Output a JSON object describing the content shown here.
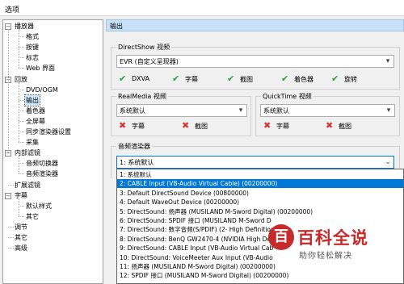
{
  "window": {
    "title": "选项"
  },
  "tree": [
    {
      "label": "播放器",
      "toggle": "−"
    },
    {
      "label": "格式"
    },
    {
      "label": "按键"
    },
    {
      "label": "标志"
    },
    {
      "label": "Web 界面"
    },
    {
      "label": "回放",
      "toggle": "−"
    },
    {
      "label": "DVD/OGM"
    },
    {
      "label": "输出"
    },
    {
      "label": "着色器"
    },
    {
      "label": "全屏幕"
    },
    {
      "label": "同步渲染器设置"
    },
    {
      "label": "采集"
    },
    {
      "label": "内部滤镜",
      "toggle": "−"
    },
    {
      "label": "音频切换器"
    },
    {
      "label": "音频渲染器"
    },
    {
      "label": "扩展滤镜"
    },
    {
      "label": "字幕",
      "toggle": "−"
    },
    {
      "label": "默认样式"
    },
    {
      "label": "其它"
    },
    {
      "label": "调节"
    },
    {
      "label": "其它"
    },
    {
      "label": "高级"
    }
  ],
  "panel": {
    "header": "输出",
    "directshow": {
      "label": "DirectShow 视频",
      "value": "EVR (自定义呈现器)",
      "features": [
        {
          "icon": "check-icon",
          "glyph": "✔",
          "label": "DXVA"
        },
        {
          "icon": "check-icon",
          "glyph": "✔",
          "label": "字幕"
        },
        {
          "icon": "check-icon",
          "glyph": "✔",
          "label": "截图"
        },
        {
          "icon": "check-icon",
          "glyph": "✔",
          "label": "着色器"
        },
        {
          "icon": "check-icon",
          "glyph": "✔",
          "label": "旋转"
        }
      ]
    },
    "realmedia": {
      "label": "RealMedia 视频",
      "value": "系统默认",
      "features": [
        {
          "icon": "cross-icon",
          "glyph": "✖",
          "label": "字幕"
        },
        {
          "icon": "cross-icon",
          "glyph": "✖",
          "label": "截图"
        }
      ]
    },
    "quicktime": {
      "label": "QuickTime 视频",
      "value": "系统默认",
      "features": [
        {
          "icon": "cross-icon",
          "glyph": "✖",
          "label": "字幕"
        },
        {
          "icon": "cross-icon",
          "glyph": "✖",
          "label": "截图"
        }
      ]
    },
    "audio": {
      "label": "音频渲染器",
      "value": "1: 系统默认",
      "arrow": "⌄",
      "options": [
        "1: 系统默认",
        "2: CABLE Input (VB-Audio Virtual Cable) (00200000)",
        "3: Default DirectSound Device (00800000)",
        "4: Default WaveOut Device (00200000)",
        "5: DirectSound: 扬声器 (MUSILAND M-Sword Digital) (00200000)",
        "6: DirectSound: SPDIF 接口 (MUSILAND M-Sword D",
        "7: DirectSound: 数字音频(S/PDIF) (2- High Definition",
        "8: DirectSound: BenQ GW2470-4 (NVIDIA High De",
        "9: DirectSound: CABLE Input (VB-Audio Virtual Cab",
        "10: DirectSound: VoiceMeeter Aux Input (VB-Audio",
        "11: 扬声器 (MUSILAND M-Sword Digital) (00200000)",
        "12: SPDIF 接口 (MUSILAND M-Sword Digital) (00200000)"
      ],
      "highlighted_index": 1
    },
    "arrow": "▾"
  },
  "watermark": {
    "icon": "百",
    "title": "百科全说",
    "subtitle": "助你轻松解决"
  }
}
